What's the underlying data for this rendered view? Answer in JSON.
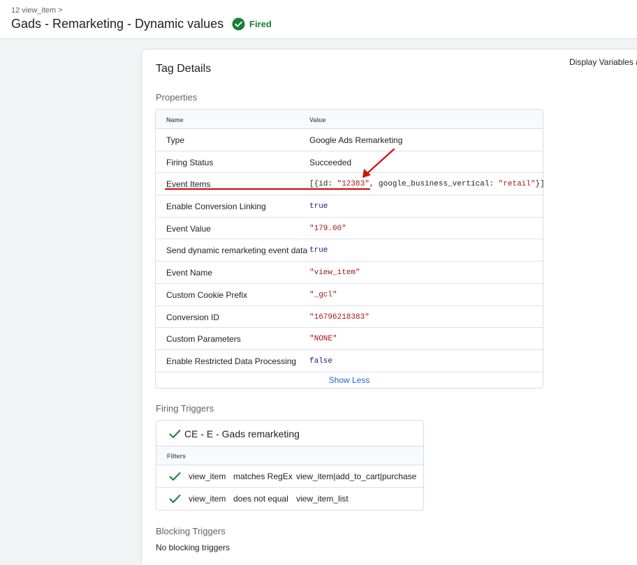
{
  "header": {
    "breadcrumb": "12 view_item >",
    "title": "Gads - Remarketing - Dynamic values",
    "status": "Fired"
  },
  "display_variables": "Display Variables a",
  "tag_details": {
    "title": "Tag Details",
    "properties_label": "Properties",
    "columns": {
      "name": "Name",
      "value": "Value"
    },
    "rows": [
      {
        "name": "Type",
        "value": "Google Ads Remarketing"
      },
      {
        "name": "Firing Status",
        "value": "Succeeded"
      },
      {
        "name": "Event Items",
        "value_parts": {
          "open": "[{id: ",
          "id": "\"12383\"",
          "mid": ", google_business_vertical: ",
          "vertical": "\"retail\"",
          "close": "}]"
        }
      },
      {
        "name": "Enable Conversion Linking",
        "value": "true"
      },
      {
        "name": "Event Value",
        "value": "\"179.00\""
      },
      {
        "name": "Send dynamic remarketing event data",
        "value": "true"
      },
      {
        "name": "Event Name",
        "value": "\"view_item\""
      },
      {
        "name": "Custom Cookie Prefix",
        "value": "\"_gcl\""
      },
      {
        "name": "Conversion ID",
        "value": "\"16796218383\""
      },
      {
        "name": "Custom Parameters",
        "value": "\"NONE\""
      },
      {
        "name": "Enable Restricted Data Processing",
        "value": "false"
      }
    ],
    "show_less": "Show Less"
  },
  "firing_triggers": {
    "label": "Firing Triggers",
    "trigger_name": "CE - E - Gads remarketing",
    "filters_label": "Filters",
    "filters": [
      {
        "variable": "view_item",
        "operator": "matches RegEx",
        "value": "view_item|add_to_cart|purchase"
      },
      {
        "variable": "view_item",
        "operator": "does not equal",
        "value": "view_item_list"
      }
    ]
  },
  "blocking_triggers": {
    "label": "Blocking Triggers",
    "empty_text": "No blocking triggers"
  },
  "colors": {
    "fired_green": "#188038",
    "link_blue": "#1967d2",
    "string_red": "#a31515",
    "keyword_navy": "#1a1a7e",
    "annotation_red": "#d01010"
  }
}
